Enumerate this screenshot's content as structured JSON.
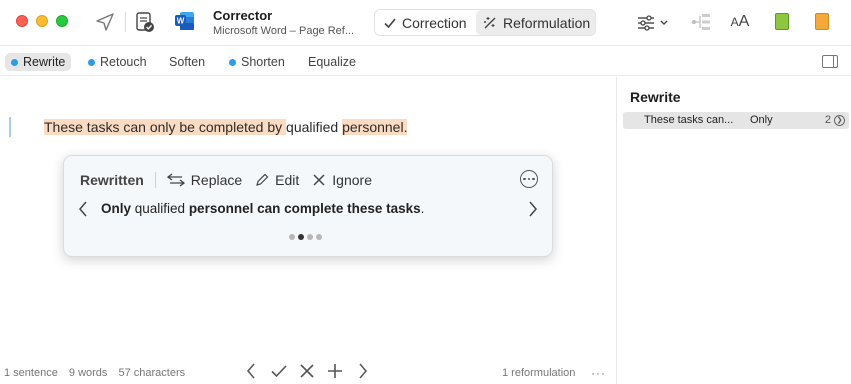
{
  "window": {
    "title": "Corrector",
    "subtitle": "Microsoft Word – Page Ref..."
  },
  "mode_switch": {
    "correction_label": "Correction",
    "reformulation_label": "Reformulation",
    "selected": "Reformulation"
  },
  "toolbar_icons": [
    "send-icon",
    "document-check-icon",
    "word-icon",
    "sliders-icon",
    "tree-icon",
    "text-size-icon",
    "green-book-icon",
    "orange-book-icon"
  ],
  "tabs": [
    {
      "label": "Rewrite",
      "dot": true,
      "active": true
    },
    {
      "label": "Retouch",
      "dot": true,
      "active": false
    },
    {
      "label": "Soften",
      "dot": false,
      "active": false
    },
    {
      "label": "Shorten",
      "dot": true,
      "active": false
    },
    {
      "label": "Equalize",
      "dot": false,
      "active": false
    }
  ],
  "editor": {
    "sentence_parts": [
      {
        "text": "These tasks can only be completed by ",
        "highlight": true
      },
      {
        "text": "qualified",
        "highlight": false
      },
      {
        "text": " ",
        "highlight": false
      },
      {
        "text": "personnel.",
        "highlight": true
      }
    ]
  },
  "popup": {
    "title": "Rewritten",
    "replace_label": "Replace",
    "edit_label": "Edit",
    "ignore_label": "Ignore",
    "suggestion_parts": [
      {
        "text": "Only",
        "bold": true
      },
      {
        "text": " qualified ",
        "bold": false
      },
      {
        "text": "personnel can complete these tasks",
        "bold": true
      },
      {
        "text": ".",
        "bold": false
      }
    ],
    "page_count": 4,
    "current_page": 2
  },
  "status": {
    "sentences": "1 sentence",
    "words": "9 words",
    "characters": "57 characters",
    "reformulations": "1 reformulation",
    "more": "···"
  },
  "sidebar": {
    "title": "Rewrite",
    "rows": [
      {
        "excerpt": "These tasks can...",
        "word": "Only",
        "count": "2"
      }
    ]
  },
  "colors": {
    "highlight": "#fbdcc2",
    "tab_dot": "#2a9de5",
    "traffic_red": "#fe5f57",
    "traffic_yellow": "#febc2e",
    "traffic_green": "#28c840"
  }
}
